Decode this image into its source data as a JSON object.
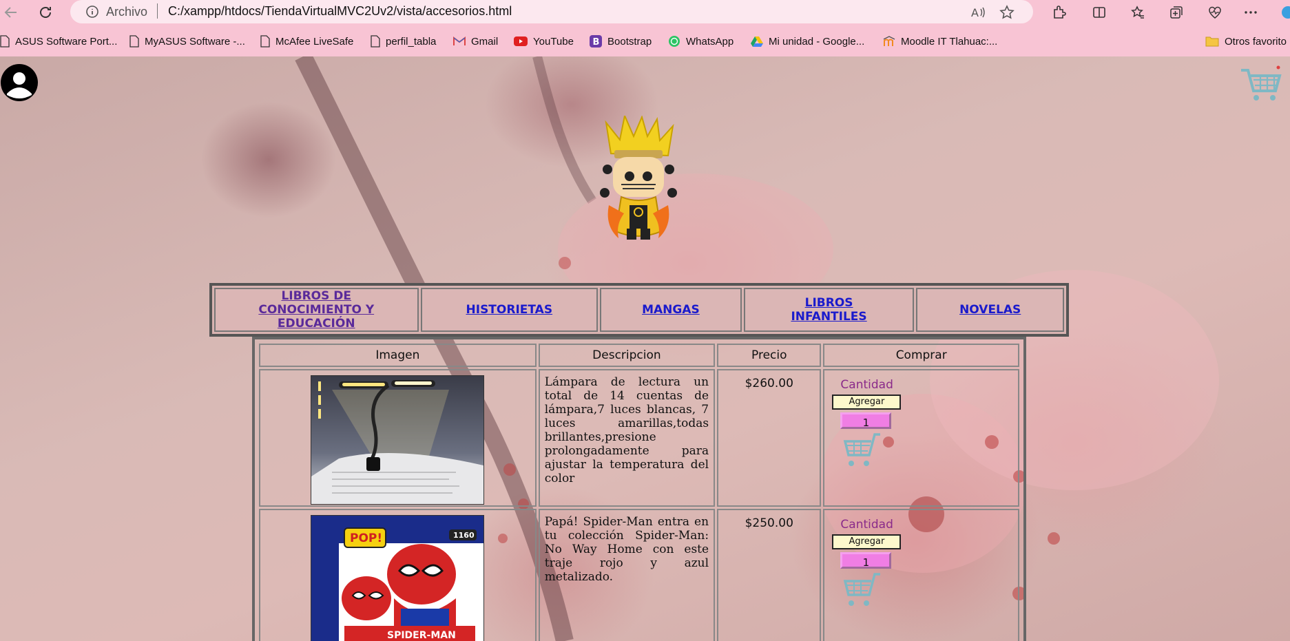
{
  "browser": {
    "address_scheme": "Archivo",
    "url": "C:/xampp/htdocs/TiendaVirtualMVC2Uv2/vista/accesorios.html",
    "bookmarks": [
      {
        "label": "ASUS Software Port...",
        "icon": "page-icon"
      },
      {
        "label": "MyASUS Software -...",
        "icon": "page-icon"
      },
      {
        "label": "McAfee LiveSafe",
        "icon": "page-icon"
      },
      {
        "label": "perfil_tabla",
        "icon": "page-icon"
      },
      {
        "label": "Gmail",
        "icon": "gmail-icon"
      },
      {
        "label": "YouTube",
        "icon": "youtube-icon"
      },
      {
        "label": "Bootstrap",
        "icon": "bootstrap-icon"
      },
      {
        "label": "WhatsApp",
        "icon": "whatsapp-icon"
      },
      {
        "label": "Mi unidad - Google...",
        "icon": "google-drive-icon"
      },
      {
        "label": "Moodle IT Tlahuac:...",
        "icon": "moodle-icon"
      }
    ],
    "other_favorites": "Otros favorito"
  },
  "nav": {
    "categories": [
      {
        "label": "LIBROS DE CONOCIMIENTO Y EDUCACIÓN",
        "visited": true
      },
      {
        "label": "HISTORIETAS",
        "visited": false
      },
      {
        "label": "MANGAS",
        "visited": false
      },
      {
        "label": "LIBROS INFANTILES",
        "visited": false
      },
      {
        "label": "NOVELAS",
        "visited": false
      }
    ]
  },
  "table": {
    "headers": [
      "Imagen",
      "Descripcion",
      "Precio",
      "Comprar"
    ],
    "rows": [
      {
        "image": "reading-lamp-image",
        "description": "Lámpara de lectura un total de 14 cuentas de lámpara,7 luces blancas, 7 luces amarillas,todas brillantes,presione prolongadamente para ajustar la temperatura del color",
        "price": "$260.00",
        "quantity_label": "Cantidad",
        "add_label": "Agregar",
        "quantity": "1"
      },
      {
        "image": "spiderman-funko-image",
        "description": "Papá! Spider-Man entra en tu colección Spider-Man: No Way Home con este traje rojo y azul metalizado.",
        "price": "$250.00",
        "quantity_label": "Cantidad",
        "add_label": "Agregar",
        "quantity": "1"
      }
    ]
  },
  "funko_box": {
    "brand": "POP!",
    "number": "1160",
    "name": "SPIDER-MAN"
  },
  "colors": {
    "chrome": "#f8c4d4",
    "link": "#1a1acc",
    "visited_link": "#5a2a9a",
    "add_button": "#fdf8cc",
    "quantity_box": "#f07ee4",
    "cart": "#7fb8c4"
  }
}
